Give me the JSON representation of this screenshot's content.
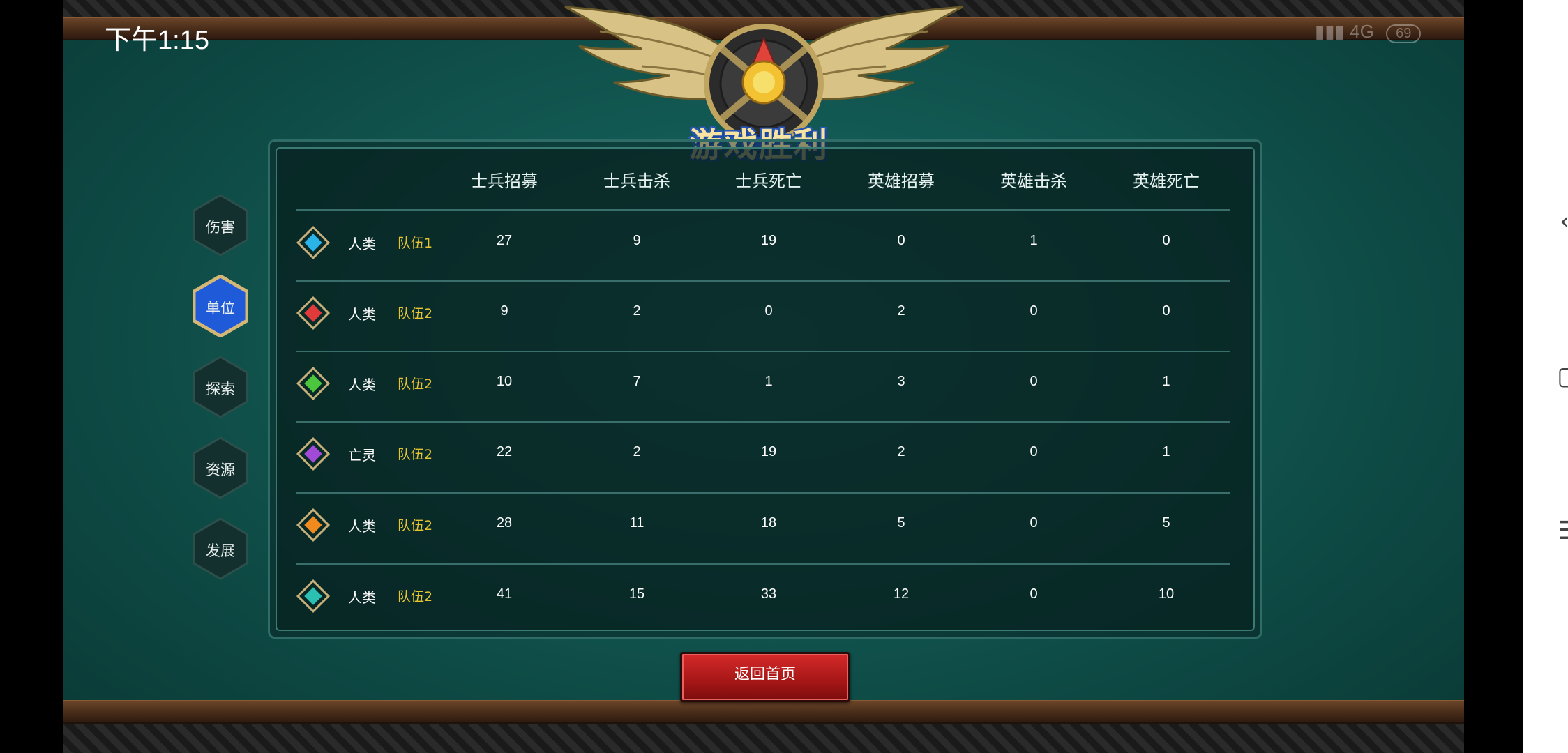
{
  "status": {
    "time": "下午1:15",
    "network": "4G",
    "battery": "69"
  },
  "title": "游戏胜利",
  "side_tabs": [
    "伤害",
    "单位",
    "探索",
    "资源",
    "发展"
  ],
  "active_tab": "单位",
  "table": {
    "headers": [
      "士兵招募",
      "士兵击杀",
      "士兵死亡",
      "英雄招募",
      "英雄击杀",
      "英雄死亡"
    ],
    "rows": [
      {
        "gem_color": "#2ab4e8",
        "race": "人类",
        "team": "队伍1",
        "values": [
          "27",
          "9",
          "19",
          "0",
          "1",
          "0"
        ]
      },
      {
        "gem_color": "#e03a3a",
        "race": "人类",
        "team": "队伍2",
        "values": [
          "9",
          "2",
          "0",
          "2",
          "0",
          "0"
        ]
      },
      {
        "gem_color": "#4cc63c",
        "race": "人类",
        "team": "队伍2",
        "values": [
          "10",
          "7",
          "1",
          "3",
          "0",
          "1"
        ]
      },
      {
        "gem_color": "#a24ad8",
        "race": "亡灵",
        "team": "队伍2",
        "values": [
          "22",
          "2",
          "19",
          "2",
          "0",
          "1"
        ]
      },
      {
        "gem_color": "#f08a1e",
        "race": "人类",
        "team": "队伍2",
        "values": [
          "28",
          "11",
          "18",
          "5",
          "0",
          "5"
        ]
      },
      {
        "gem_color": "#2cc0b2",
        "race": "人类",
        "team": "队伍2",
        "values": [
          "41",
          "15",
          "33",
          "12",
          "0",
          "10"
        ]
      }
    ]
  },
  "home_button": "返回首页",
  "colors": {
    "team_label": "#e8c530",
    "button_red": "#c01f1f",
    "active_tab": "#1f5ad8"
  },
  "icons": [
    "back-icon",
    "home-icon",
    "menu-icon"
  ]
}
